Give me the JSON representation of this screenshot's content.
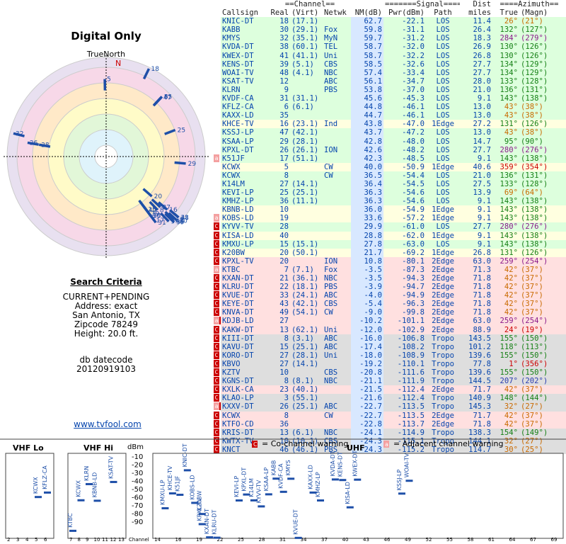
{
  "title": "Digital Only",
  "polar": {
    "north_label": "TrueNorth",
    "north_marker": "N"
  },
  "criteria": {
    "heading": "Search Criteria",
    "lines": [
      "CURRENT+PENDING",
      "Address: exact",
      "San Antonio, TX",
      "Zipcode 78249",
      "Height: 20.0 ft.",
      "",
      "db datecode",
      "20120919103"
    ]
  },
  "site_link": "www.tvfool.com",
  "table": {
    "hdr1": {
      "channel": "==Channel==",
      "signal": "=======Signal=======",
      "dist": "Dist",
      "azimuth": "====Azimuth=="
    },
    "hdr2": {
      "callsign": "Callsign",
      "real": "Real",
      "virt": "(Virt)",
      "netwk": "Netwk",
      "nm": "NM(dB)",
      "pwr": "Pwr(dBm)",
      "path": "Path",
      "miles": "miles",
      "true": "True",
      "magn": "(Magn)"
    },
    "rows": [
      {
        "w": "",
        "cs": "KNIC-DT",
        "real": "18",
        "virt": "(17.1)",
        "net": "",
        "nm": "62.7",
        "pwr": "-22.1",
        "path": "LOS",
        "mi": "11.4",
        "t": "26°",
        "m": "(21°)",
        "c": "#c96a00"
      },
      {
        "w": "",
        "cs": "KABB",
        "real": "30",
        "virt": "(29.1)",
        "net": "Fox",
        "nm": "59.8",
        "pwr": "-31.1",
        "path": "LOS",
        "mi": "26.4",
        "t": "132°",
        "m": "(127°)",
        "c": "#168016"
      },
      {
        "w": "",
        "cs": "KMYS",
        "real": "32",
        "virt": "(35.1)",
        "net": "MyN",
        "nm": "59.7",
        "pwr": "-31.2",
        "path": "LOS",
        "mi": "18.3",
        "t": "284°",
        "m": "(279°)",
        "c": "#8b1a8b"
      },
      {
        "w": "",
        "cs": "KVDA-DT",
        "real": "38",
        "virt": "(60.1)",
        "net": "TEL",
        "nm": "58.7",
        "pwr": "-32.0",
        "path": "LOS",
        "mi": "26.9",
        "t": "130°",
        "m": "(126°)",
        "c": "#168016"
      },
      {
        "w": "",
        "cs": "KWEX-DT",
        "real": "41",
        "virt": "(41.1)",
        "net": "Uni",
        "nm": "58.7",
        "pwr": "-32.2",
        "path": "LOS",
        "mi": "26.8",
        "t": "130°",
        "m": "(126°)",
        "c": "#168016"
      },
      {
        "w": "",
        "cs": "KENS-DT",
        "real": "39",
        "virt": "(5.1)",
        "net": "CBS",
        "nm": "58.5",
        "pwr": "-32.6",
        "path": "LOS",
        "mi": "27.7",
        "t": "134°",
        "m": "(129°)",
        "c": "#168016"
      },
      {
        "w": "",
        "cs": "WOAI-TV",
        "real": "48",
        "virt": "(4.1)",
        "net": "NBC",
        "nm": "57.4",
        "pwr": "-33.4",
        "path": "LOS",
        "mi": "27.7",
        "t": "134°",
        "m": "(129°)",
        "c": "#168016"
      },
      {
        "w": "",
        "cs": "KSAT-TV",
        "real": "12",
        "virt": "",
        "net": "ABC",
        "nm": "56.1",
        "pwr": "-34.7",
        "path": "LOS",
        "mi": "28.0",
        "t": "133°",
        "m": "(128°)",
        "c": "#168016"
      },
      {
        "w": "",
        "cs": "KLRN",
        "real": "9",
        "virt": "",
        "net": "PBS",
        "nm": "53.8",
        "pwr": "-37.0",
        "path": "LOS",
        "mi": "21.0",
        "t": "136°",
        "m": "(131°)",
        "c": "#168016"
      },
      {
        "w": "",
        "cs": "KVDF-CA",
        "real": "31",
        "virt": "(31.1)",
        "net": "",
        "nm": "45.6",
        "pwr": "-45.3",
        "path": "LOS",
        "mi": "9.1",
        "t": "143°",
        "m": "(138°)",
        "c": "#168016"
      },
      {
        "w": "",
        "cs": "KFLZ-CA",
        "real": "6",
        "virt": "(6.1)",
        "net": "",
        "nm": "44.8",
        "pwr": "-46.1",
        "path": "LOS",
        "mi": "13.0",
        "t": "43°",
        "m": "(38°)",
        "c": "#c96a00"
      },
      {
        "w": "",
        "cs": "KAXX-LD",
        "real": "35",
        "virt": "",
        "net": "",
        "nm": "44.7",
        "pwr": "-46.1",
        "path": "LOS",
        "mi": "13.0",
        "t": "43°",
        "m": "(38°)",
        "c": "#c96a00"
      },
      {
        "w": "",
        "cs": "KHCE-TV",
        "real": "16",
        "virt": "(23.1)",
        "net": "Ind",
        "nm": "43.8",
        "pwr": "-47.0",
        "path": "1Edge",
        "mi": "27.2",
        "t": "131°",
        "m": "(126°)",
        "c": "#168016"
      },
      {
        "w": "",
        "cs": "KSSJ-LP",
        "real": "47",
        "virt": "(42.1)",
        "net": "",
        "nm": "43.7",
        "pwr": "-47.2",
        "path": "LOS",
        "mi": "13.0",
        "t": "43°",
        "m": "(38°)",
        "c": "#c96a00"
      },
      {
        "w": "",
        "cs": "KSAA-LP",
        "real": "29",
        "virt": "(28.1)",
        "net": "",
        "nm": "42.8",
        "pwr": "-48.0",
        "path": "LOS",
        "mi": "14.7",
        "t": "95°",
        "m": "(90°)",
        "c": "#168016"
      },
      {
        "w": "",
        "cs": "KPXL-DT",
        "real": "26",
        "virt": "(26.1)",
        "net": "ION",
        "nm": "42.6",
        "pwr": "-48.2",
        "path": "LOS",
        "mi": "27.7",
        "t": "280°",
        "m": "(276°)",
        "c": "#8b1a8b"
      },
      {
        "w": "a",
        "cs": "K51JF",
        "real": "17",
        "virt": "(51.1)",
        "net": "",
        "nm": "42.3",
        "pwr": "-48.5",
        "path": "LOS",
        "mi": "9.1",
        "t": "143°",
        "m": "(138°)",
        "c": "#168016"
      },
      {
        "w": "",
        "cs": "KCWX",
        "real": "5",
        "virt": "",
        "net": "CW",
        "nm": "40.0",
        "pwr": "-50.9",
        "path": "1Edge",
        "mi": "40.6",
        "t": "359°",
        "m": "(354°)",
        "c": "#c00"
      },
      {
        "w": "",
        "cs": "KCWX",
        "real": "8",
        "virt": "",
        "net": "CW",
        "nm": "36.5",
        "pwr": "-54.4",
        "path": "LOS",
        "mi": "21.0",
        "t": "136°",
        "m": "(131°)",
        "c": "#168016"
      },
      {
        "w": "",
        "cs": "K14LM",
        "real": "27",
        "virt": "(14.1)",
        "net": "",
        "nm": "36.4",
        "pwr": "-54.5",
        "path": "LOS",
        "mi": "27.5",
        "t": "133°",
        "m": "(128°)",
        "c": "#168016"
      },
      {
        "w": "",
        "cs": "KEVI-LP",
        "real": "25",
        "virt": "(25.1)",
        "net": "",
        "nm": "36.3",
        "pwr": "-54.6",
        "path": "LOS",
        "mi": "13.9",
        "t": "69°",
        "m": "(64°)",
        "c": "#c96a00"
      },
      {
        "w": "",
        "cs": "KMHZ-LP",
        "real": "36",
        "virt": "(11.1)",
        "net": "",
        "nm": "36.3",
        "pwr": "-54.6",
        "path": "LOS",
        "mi": "9.1",
        "t": "143°",
        "m": "(138°)",
        "c": "#168016"
      },
      {
        "w": "",
        "cs": "KBNB-LD",
        "real": "10",
        "virt": "",
        "net": "",
        "nm": "36.0",
        "pwr": "-54.9",
        "path": "1Edge",
        "mi": "9.1",
        "t": "143°",
        "m": "(138°)",
        "c": "#168016"
      },
      {
        "w": "a",
        "cs": "KOBS-LD",
        "real": "19",
        "virt": "",
        "net": "",
        "nm": "33.6",
        "pwr": "-57.2",
        "path": "1Edge",
        "mi": "9.1",
        "t": "143°",
        "m": "(138°)",
        "c": "#168016"
      },
      {
        "w": "c",
        "cs": "KYVV-TV",
        "real": "28",
        "virt": "",
        "net": "",
        "nm": "29.9",
        "pwr": "-61.0",
        "path": "LOS",
        "mi": "27.7",
        "t": "280°",
        "m": "(276°)",
        "c": "#8b1a8b"
      },
      {
        "w": "c",
        "cs": "KISA-LD",
        "real": "40",
        "virt": "",
        "net": "",
        "nm": "28.8",
        "pwr": "-62.0",
        "path": "1Edge",
        "mi": "9.1",
        "t": "143°",
        "m": "(138°)",
        "c": "#168016"
      },
      {
        "w": "c",
        "cs": "KMXU-LP",
        "real": "15",
        "virt": "(15.1)",
        "net": "",
        "nm": "27.8",
        "pwr": "-63.0",
        "path": "LOS",
        "mi": "9.1",
        "t": "143°",
        "m": "(138°)",
        "c": "#168016"
      },
      {
        "w": "c",
        "cs": "K20BW",
        "real": "20",
        "virt": "(50.1)",
        "net": "",
        "nm": "21.7",
        "pwr": "-69.2",
        "path": "1Edge",
        "mi": "26.8",
        "t": "131°",
        "m": "(126°)",
        "c": "#168016"
      },
      {
        "w": "c",
        "cs": "KPXL-TV",
        "real": "20",
        "virt": "",
        "net": "ION",
        "nm": "10.8",
        "pwr": "-80.1",
        "path": "2Edge",
        "mi": "63.0",
        "t": "259°",
        "m": "(254°)",
        "c": "#8b1a8b"
      },
      {
        "w": "a",
        "cs": "KTBC",
        "real": "7",
        "virt": "(7.1)",
        "net": "Fox",
        "nm": "-3.5",
        "pwr": "-87.3",
        "path": "2Edge",
        "mi": "71.3",
        "t": "42°",
        "m": "(37°)",
        "c": "#c96a00"
      },
      {
        "w": "c",
        "cs": "KXAN-DT",
        "real": "21",
        "virt": "(36.1)",
        "net": "NBC",
        "nm": "-3.5",
        "pwr": "-94.3",
        "path": "2Edge",
        "mi": "71.8",
        "t": "42°",
        "m": "(37°)",
        "c": "#c96a00"
      },
      {
        "w": "c",
        "cs": "KLRU-DT",
        "real": "22",
        "virt": "(18.1)",
        "net": "PBS",
        "nm": "-3.9",
        "pwr": "-94.7",
        "path": "2Edge",
        "mi": "71.8",
        "t": "42°",
        "m": "(37°)",
        "c": "#c96a00"
      },
      {
        "w": "c",
        "cs": "KVUE-DT",
        "real": "33",
        "virt": "(24.1)",
        "net": "ABC",
        "nm": "-4.0",
        "pwr": "-94.9",
        "path": "2Edge",
        "mi": "71.8",
        "t": "42°",
        "m": "(37°)",
        "c": "#c96a00"
      },
      {
        "w": "c",
        "cs": "KEYE-DT",
        "real": "43",
        "virt": "(42.1)",
        "net": "CBS",
        "nm": "-5.4",
        "pwr": "-96.3",
        "path": "2Edge",
        "mi": "71.8",
        "t": "42°",
        "m": "(37°)",
        "c": "#c96a00"
      },
      {
        "w": "c",
        "cs": "KNVA-DT",
        "real": "49",
        "virt": "(54.1)",
        "net": "CW",
        "nm": "-9.0",
        "pwr": "-99.8",
        "path": "2Edge",
        "mi": "71.8",
        "t": "42°",
        "m": "(37°)",
        "c": "#c96a00"
      },
      {
        "w": "ac",
        "cs": "KDJB-LD",
        "real": "27",
        "virt": "",
        "net": "",
        "nm": "-10.2",
        "pwr": "-101.1",
        "path": "2Edge",
        "mi": "63.0",
        "t": "259°",
        "m": "(254°)",
        "c": "#8b1a8b"
      },
      {
        "w": "c",
        "cs": "KAKW-DT",
        "real": "13",
        "virt": "(62.1)",
        "net": "Uni",
        "nm": "-12.0",
        "pwr": "-102.9",
        "path": "2Edge",
        "mi": "88.9",
        "t": "24°",
        "m": "(19°)",
        "c": "#c00"
      },
      {
        "w": "c",
        "cs": "KIII-DT",
        "real": "8",
        "virt": "(3.1)",
        "net": "ABC",
        "nm": "-16.0",
        "pwr": "-106.8",
        "path": "Tropo",
        "mi": "143.5",
        "t": "155°",
        "m": "(150°)",
        "c": "#168016"
      },
      {
        "w": "c",
        "cs": "KAVU-DT",
        "real": "15",
        "virt": "(25.1)",
        "net": "ABC",
        "nm": "-17.4",
        "pwr": "-108.2",
        "path": "Tropo",
        "mi": "101.2",
        "t": "118°",
        "m": "(113°)",
        "c": "#168016"
      },
      {
        "w": "c",
        "cs": "KORO-DT",
        "real": "27",
        "virt": "(28.1)",
        "net": "Uni",
        "nm": "-18.0",
        "pwr": "-108.9",
        "path": "Tropo",
        "mi": "139.6",
        "t": "155°",
        "m": "(150°)",
        "c": "#168016"
      },
      {
        "w": "c",
        "cs": "KBVO",
        "real": "27",
        "virt": "(14.1)",
        "net": "",
        "nm": "-19.2",
        "pwr": "-110.1",
        "path": "Tropo",
        "mi": "77.8",
        "t": "1°",
        "m": "(356°)",
        "c": "#c00"
      },
      {
        "w": "c",
        "cs": "KZTV",
        "real": "10",
        "virt": "",
        "net": "CBS",
        "nm": "-20.8",
        "pwr": "-111.6",
        "path": "Tropo",
        "mi": "139.6",
        "t": "155°",
        "m": "(150°)",
        "c": "#168016"
      },
      {
        "w": "c",
        "cs": "KGNS-DT",
        "real": "8",
        "virt": "(8.1)",
        "net": "NBC",
        "nm": "-21.1",
        "pwr": "-111.9",
        "path": "Tropo",
        "mi": "144.5",
        "t": "207°",
        "m": "(202°)",
        "c": "#2a3cb0"
      },
      {
        "w": "c",
        "cs": "KXLK-CA",
        "real": "23",
        "virt": "(40.1)",
        "net": "",
        "nm": "-21.5",
        "pwr": "-112.4",
        "path": "2Edge",
        "mi": "71.7",
        "t": "42°",
        "m": "(37°)",
        "c": "#c96a00"
      },
      {
        "w": "c",
        "cs": "KLAO-LP",
        "real": "3",
        "virt": "(55.1)",
        "net": "",
        "nm": "-21.6",
        "pwr": "-112.4",
        "path": "Tropo",
        "mi": "140.9",
        "t": "148°",
        "m": "(144°)",
        "c": "#168016"
      },
      {
        "w": "ac",
        "cs": "KXXV-DT",
        "real": "26",
        "virt": "(25.1)",
        "net": "ABC",
        "nm": "-22.7",
        "pwr": "-113.5",
        "path": "Tropo",
        "mi": "145.3",
        "t": "32°",
        "m": "(27°)",
        "c": "#c96a00"
      },
      {
        "w": "c",
        "cs": "KCWX",
        "real": "8",
        "virt": "",
        "net": "CW",
        "nm": "-22.7",
        "pwr": "-113.5",
        "path": "2Edge",
        "mi": "71.7",
        "t": "42°",
        "m": "(37°)",
        "c": "#c96a00"
      },
      {
        "w": "c",
        "cs": "KTFO-CD",
        "real": "36",
        "virt": "",
        "net": "",
        "nm": "-22.8",
        "pwr": "-113.7",
        "path": "2Edge",
        "mi": "71.8",
        "t": "42°",
        "m": "(37°)",
        "c": "#c96a00"
      },
      {
        "w": "c",
        "cs": "KRIS-DT",
        "real": "13",
        "virt": "(6.1)",
        "net": "NBC",
        "nm": "-24.1",
        "pwr": "-114.9",
        "path": "Tropo",
        "mi": "138.3",
        "t": "154°",
        "m": "(149°)",
        "c": "#168016"
      },
      {
        "w": "c",
        "cs": "KWTX-TV",
        "real": "10",
        "virt": "(10.1)",
        "net": "CBS",
        "nm": "-24.3",
        "pwr": "-115.1",
        "path": "Tropo",
        "mi": "144.1",
        "t": "32°",
        "m": "(27°)",
        "c": "#c96a00"
      },
      {
        "w": "c",
        "cs": "KNCT",
        "real": "46",
        "virt": "(46.1)",
        "net": "PBS",
        "nm": "-24.3",
        "pwr": "-115.2",
        "path": "Tropo",
        "mi": "114.7",
        "t": "30°",
        "m": "(25°)",
        "c": "#c96a00"
      }
    ]
  },
  "legend": {
    "co": "= Co-channel warning",
    "adj": "= Adjacent channel warning",
    "co_mark": "C",
    "adj_mark": "a"
  },
  "panels": {
    "vhf_lo": "VHF Lo",
    "vhf_hi": "VHF Hi",
    "uhf": "UHF",
    "dbm": "dBm",
    "channel_label": "Channel",
    "dbm_ticks": [
      "-10",
      "-20",
      "-30",
      "-40",
      "-50",
      "-60",
      "-70",
      "-80",
      "-90"
    ],
    "lo_ticks": [
      "2",
      "3",
      "4",
      "5",
      "6"
    ],
    "hi_ticks": [
      "7",
      "8",
      "9",
      "10",
      "11",
      "12",
      "13"
    ],
    "uhf_ticks": [
      "14",
      "16",
      "19",
      "22",
      "25",
      "28",
      "31",
      "34",
      "37",
      "40",
      "43",
      "46",
      "49",
      "52",
      "55",
      "58",
      "61",
      "64",
      "67",
      "69"
    ]
  }
}
